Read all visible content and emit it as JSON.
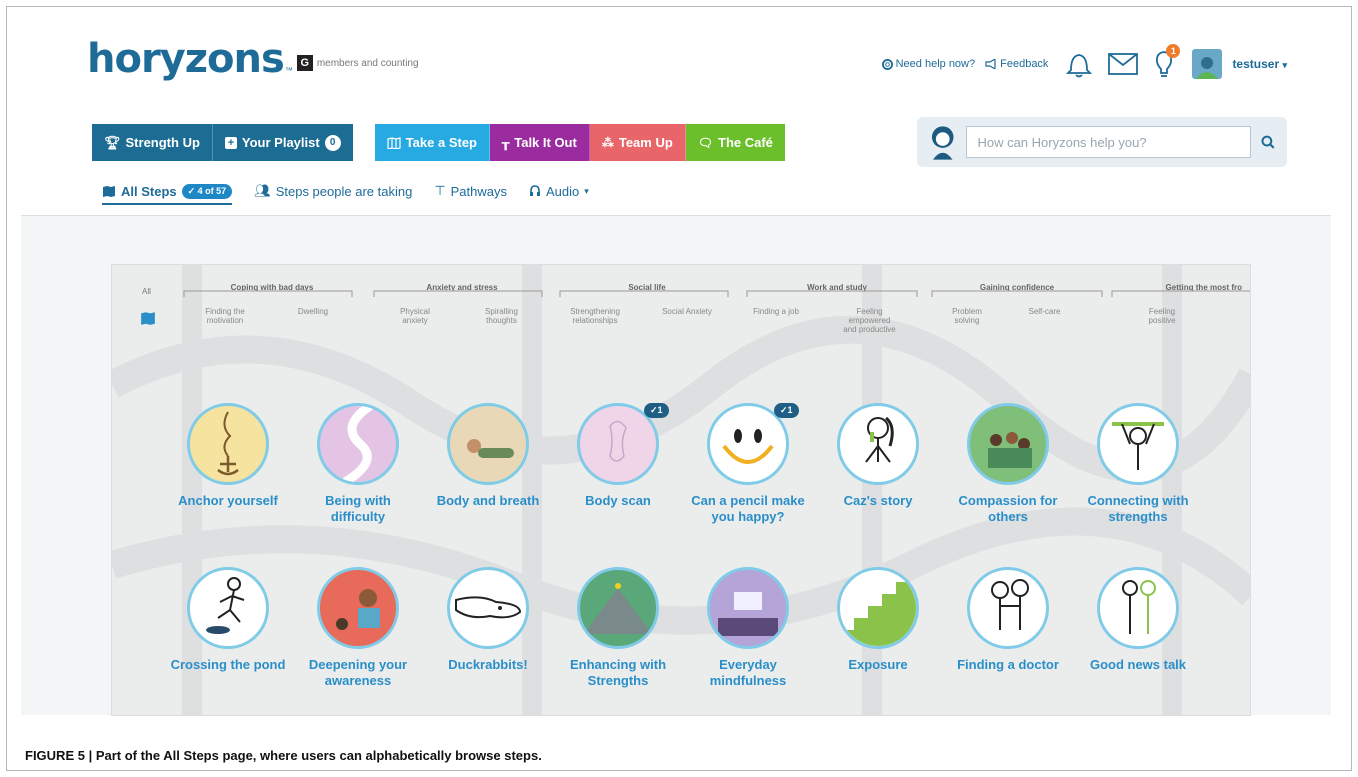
{
  "header": {
    "logo_text": "horyzons",
    "logo_tm": "™",
    "member_badge": "G",
    "member_text": "members and counting",
    "help_link": "Need help now?",
    "feedback_link": "Feedback",
    "notification_count": "1",
    "username": "testuser"
  },
  "main_nav": {
    "strength_up": "Strength Up",
    "your_playlist": "Your Playlist",
    "playlist_count": "0",
    "take_a_step": "Take a Step",
    "talk_it_out": "Talk It Out",
    "team_up": "Team Up",
    "the_cafe": "The Café"
  },
  "search": {
    "placeholder": "How can Horyzons help you?"
  },
  "sub_nav": {
    "all_steps": "All Steps",
    "all_steps_count": "✓ 4 of 57",
    "steps_people_taking": "Steps people are taking",
    "pathways": "Pathways",
    "audio": "Audio"
  },
  "filters": {
    "all": "All",
    "groups": [
      {
        "label": "Coping with bad days"
      },
      {
        "label": "Anxiety and stress"
      },
      {
        "label": "Social life"
      },
      {
        "label": "Work and study"
      },
      {
        "label": "Gaining confidence"
      },
      {
        "label": "Getting the most fro"
      }
    ],
    "subs": [
      "Finding the motivation",
      "Dwelling",
      "Physical anxiety",
      "Spiralling thoughts",
      "Strengthening relationships",
      "Social Anxiety",
      "Finding a job",
      "Feeling empowered and productive",
      "Problem solving",
      "Self-care",
      "Feeling positive"
    ]
  },
  "steps_row1": [
    {
      "title": "Anchor yourself",
      "color": "#f7e3a0"
    },
    {
      "title": "Being with difficulty",
      "color": "#e3c4e4"
    },
    {
      "title": "Body and breath",
      "color": "#e8d8b8"
    },
    {
      "title": "Body scan",
      "color": "#f0d4e8",
      "badge": "✓1"
    },
    {
      "title": "Can a pencil make you happy?",
      "color": "#ffffff",
      "badge": "✓1"
    },
    {
      "title": "Caz's story",
      "color": "#ffffff"
    },
    {
      "title": "Compassion for others",
      "color": "#7fbf7a"
    },
    {
      "title": "Connecting with strengths",
      "color": "#ffffff"
    }
  ],
  "steps_row2": [
    {
      "title": "Crossing the pond",
      "color": "#ffffff"
    },
    {
      "title": "Deepening your awareness",
      "color": "#e86a5a"
    },
    {
      "title": "Duckrabbits!",
      "color": "#ffffff"
    },
    {
      "title": "Enhancing with Strengths",
      "color": "#5aa87a"
    },
    {
      "title": "Everyday mindfulness",
      "color": "#b4a4d8"
    },
    {
      "title": "Exposure",
      "color": "#8bc34a"
    },
    {
      "title": "Finding a doctor",
      "color": "#ffffff"
    },
    {
      "title": "Good news talk",
      "color": "#ffffff"
    }
  ],
  "caption": "FIGURE 5 | Part of the All Steps page, where users can alphabetically browse steps."
}
